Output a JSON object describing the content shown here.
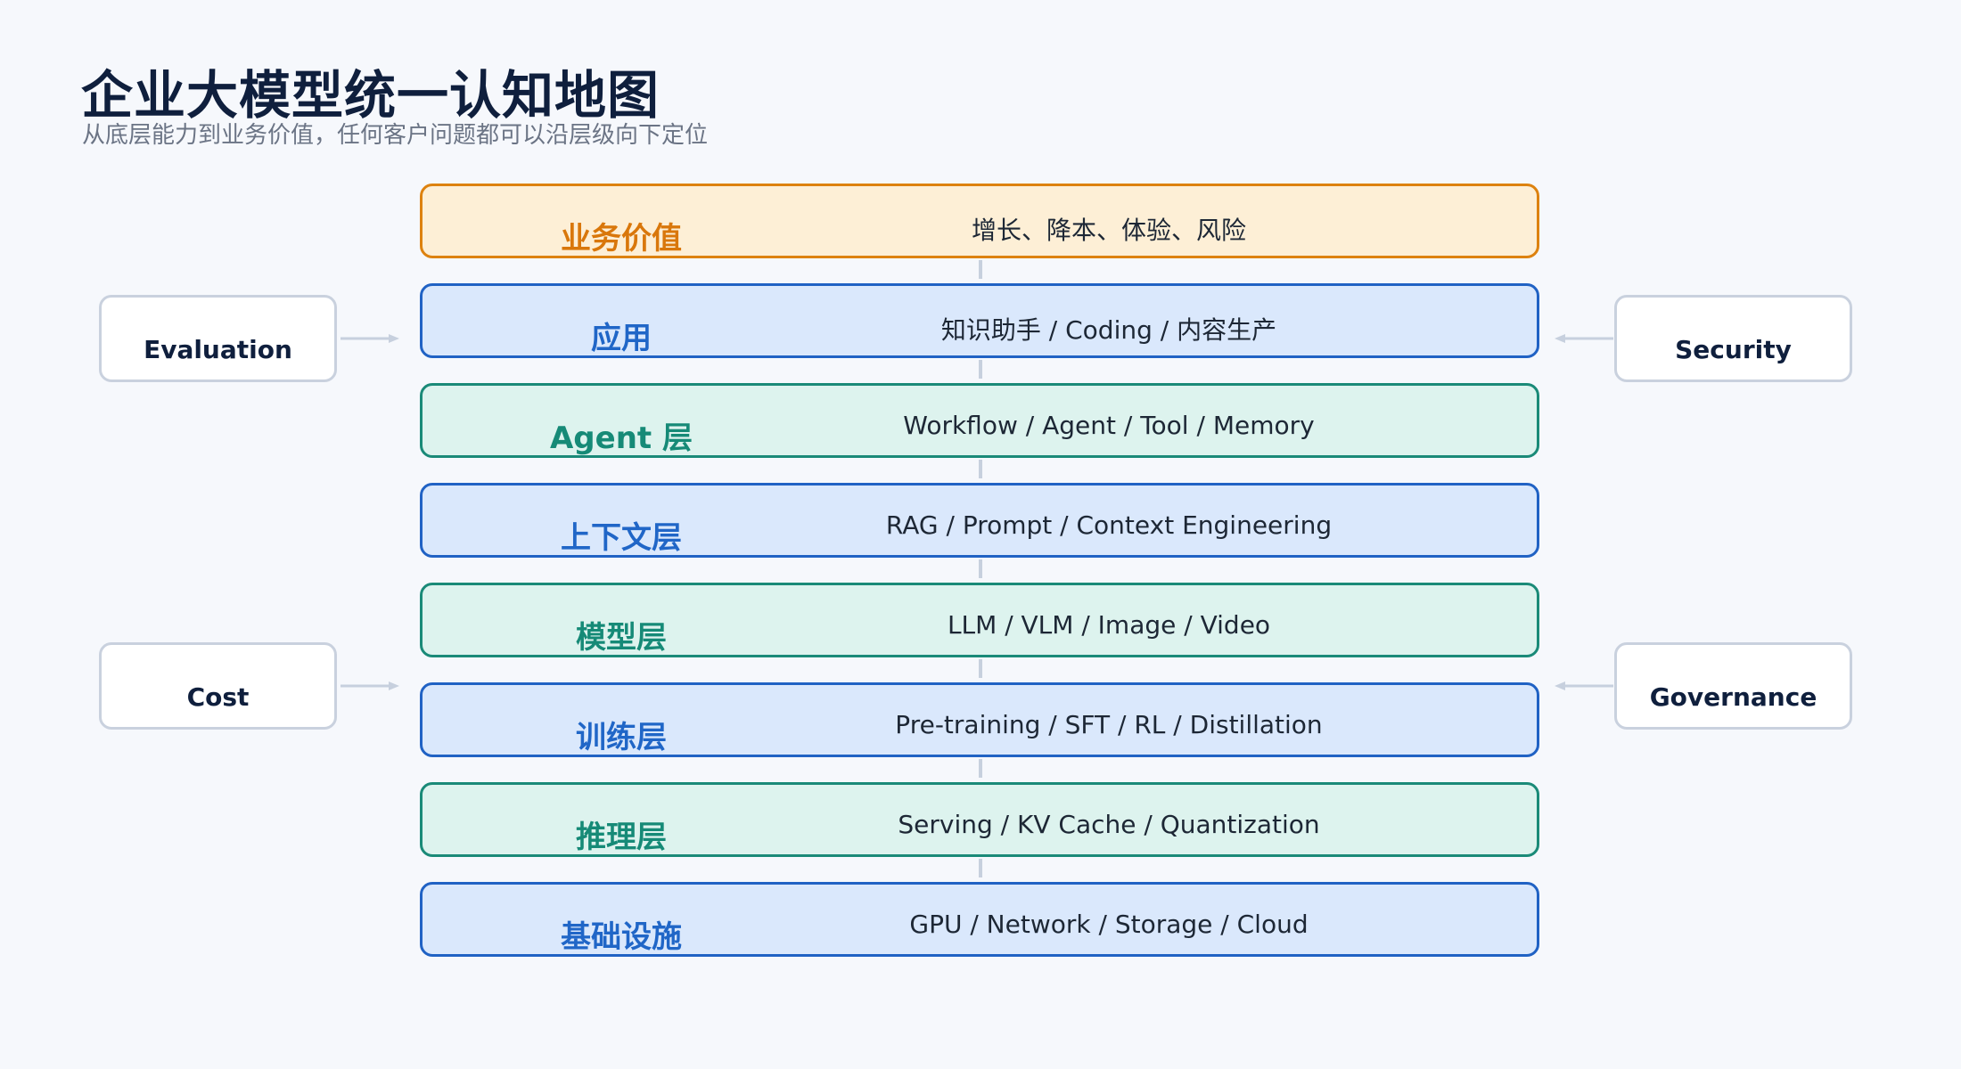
{
  "header": {
    "title": "企业大模型统一认知地图",
    "subtitle": "从底层能力到业务价值，任何客户问题都可以沿层级向下定位"
  },
  "layers": [
    {
      "name": "业务价值",
      "desc": "增长、降本、体验、风险",
      "color": "amber"
    },
    {
      "name": "应用",
      "desc": "知识助手 / Coding / 内容生产",
      "color": "blue"
    },
    {
      "name": "Agent 层",
      "desc": "Workflow / Agent / Tool / Memory",
      "color": "teal"
    },
    {
      "name": "上下文层",
      "desc": "RAG / Prompt / Context Engineering",
      "color": "blue"
    },
    {
      "name": "模型层",
      "desc": "LLM / VLM / Image / Video",
      "color": "teal"
    },
    {
      "name": "训练层",
      "desc": "Pre-training / SFT / RL / Distillation",
      "color": "blue"
    },
    {
      "name": "推理层",
      "desc": "Serving / KV Cache / Quantization",
      "color": "teal"
    },
    {
      "name": "基础设施",
      "desc": "GPU / Network / Storage / Cloud",
      "color": "blue"
    }
  ],
  "side_boxes": {
    "left_top": "Evaluation",
    "left_bottom": "Cost",
    "right_top": "Security",
    "right_bottom": "Governance"
  },
  "colors": {
    "amber_fill": "#fdefd6",
    "amber_border": "#dd820f",
    "blue_fill": "#dae8fc",
    "blue_border": "#2062c4",
    "teal_fill": "#ddf3ee",
    "teal_border": "#1a8a78",
    "connector": "#c7d0de"
  }
}
